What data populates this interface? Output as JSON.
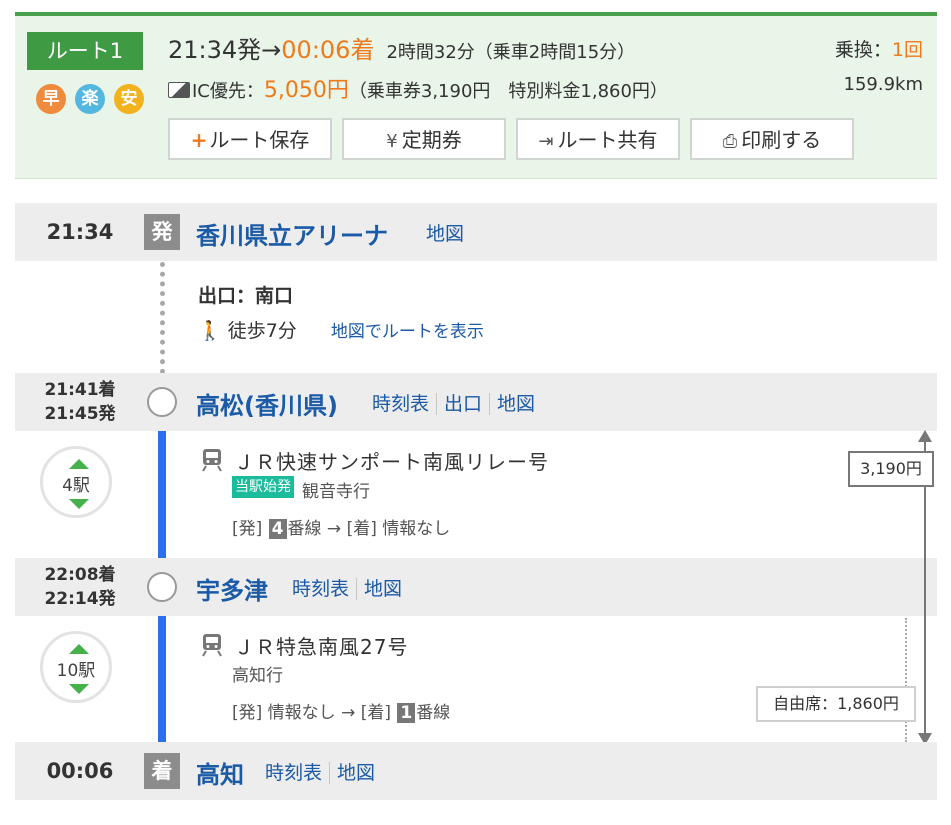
{
  "summary": {
    "route_label": "ルート1",
    "feature_icons": [
      "早",
      "楽",
      "安"
    ],
    "depart_time": "21:34発",
    "arrow": "→",
    "arrive_time": "00:06着",
    "duration": "2時間32分（乗車2時間15分）",
    "transfer_label": "乗換：",
    "transfer_count": "1回",
    "ic_label": "IC優先：",
    "price": "5,050円",
    "price_detail": "（乗車券3,190円　特別料金1,860円）",
    "distance": "159.9km",
    "buttons": {
      "save": "ルート保存",
      "pass": "定期券",
      "share": "ルート共有",
      "print": "印刷する"
    }
  },
  "stations": [
    {
      "time": "21:34",
      "mark": "発",
      "name": "香川県立アリーナ",
      "links": [
        "地図"
      ]
    },
    {
      "time_arr": "21:41着",
      "time_dep": "21:45発",
      "name": "高松(香川県)",
      "links": [
        "時刻表",
        "出口",
        "地図"
      ]
    },
    {
      "time_arr": "22:08着",
      "time_dep": "22:14発",
      "name": "宇多津",
      "links": [
        "時刻表",
        "地図"
      ]
    },
    {
      "time": "00:06",
      "mark": "着",
      "name": "高知",
      "links": [
        "時刻表",
        "地図"
      ]
    }
  ],
  "walk": {
    "exit": "出口：南口",
    "walk_text": "徒歩7分",
    "map_route": "地図でルートを表示"
  },
  "segments": [
    {
      "stops": "4駅",
      "train": "ＪＲ快速サンポート南風リレー号",
      "badge": "当駅始発",
      "dest": "観音寺行",
      "dep_label": "[発]",
      "dep_platform": "4",
      "dep_suffix": "番線",
      "arrow": "→",
      "arr_label": "[着]",
      "arr_text": "情報なし"
    },
    {
      "stops": "10駅",
      "train": "ＪＲ特急南風27号",
      "dest": "高知行",
      "dep_label": "[発]",
      "dep_text": "情報なし",
      "arrow": "→",
      "arr_label": "[着]",
      "arr_platform": "1",
      "arr_suffix": "番線"
    }
  ],
  "fares": {
    "base": "3,190円",
    "seat": "自由席：1,860円"
  },
  "colors": {
    "brand_green": "#3f9a44",
    "accent_orange": "#ee7a1a",
    "line_blue": "#2b6fee",
    "link_blue": "#1b5aa6"
  }
}
